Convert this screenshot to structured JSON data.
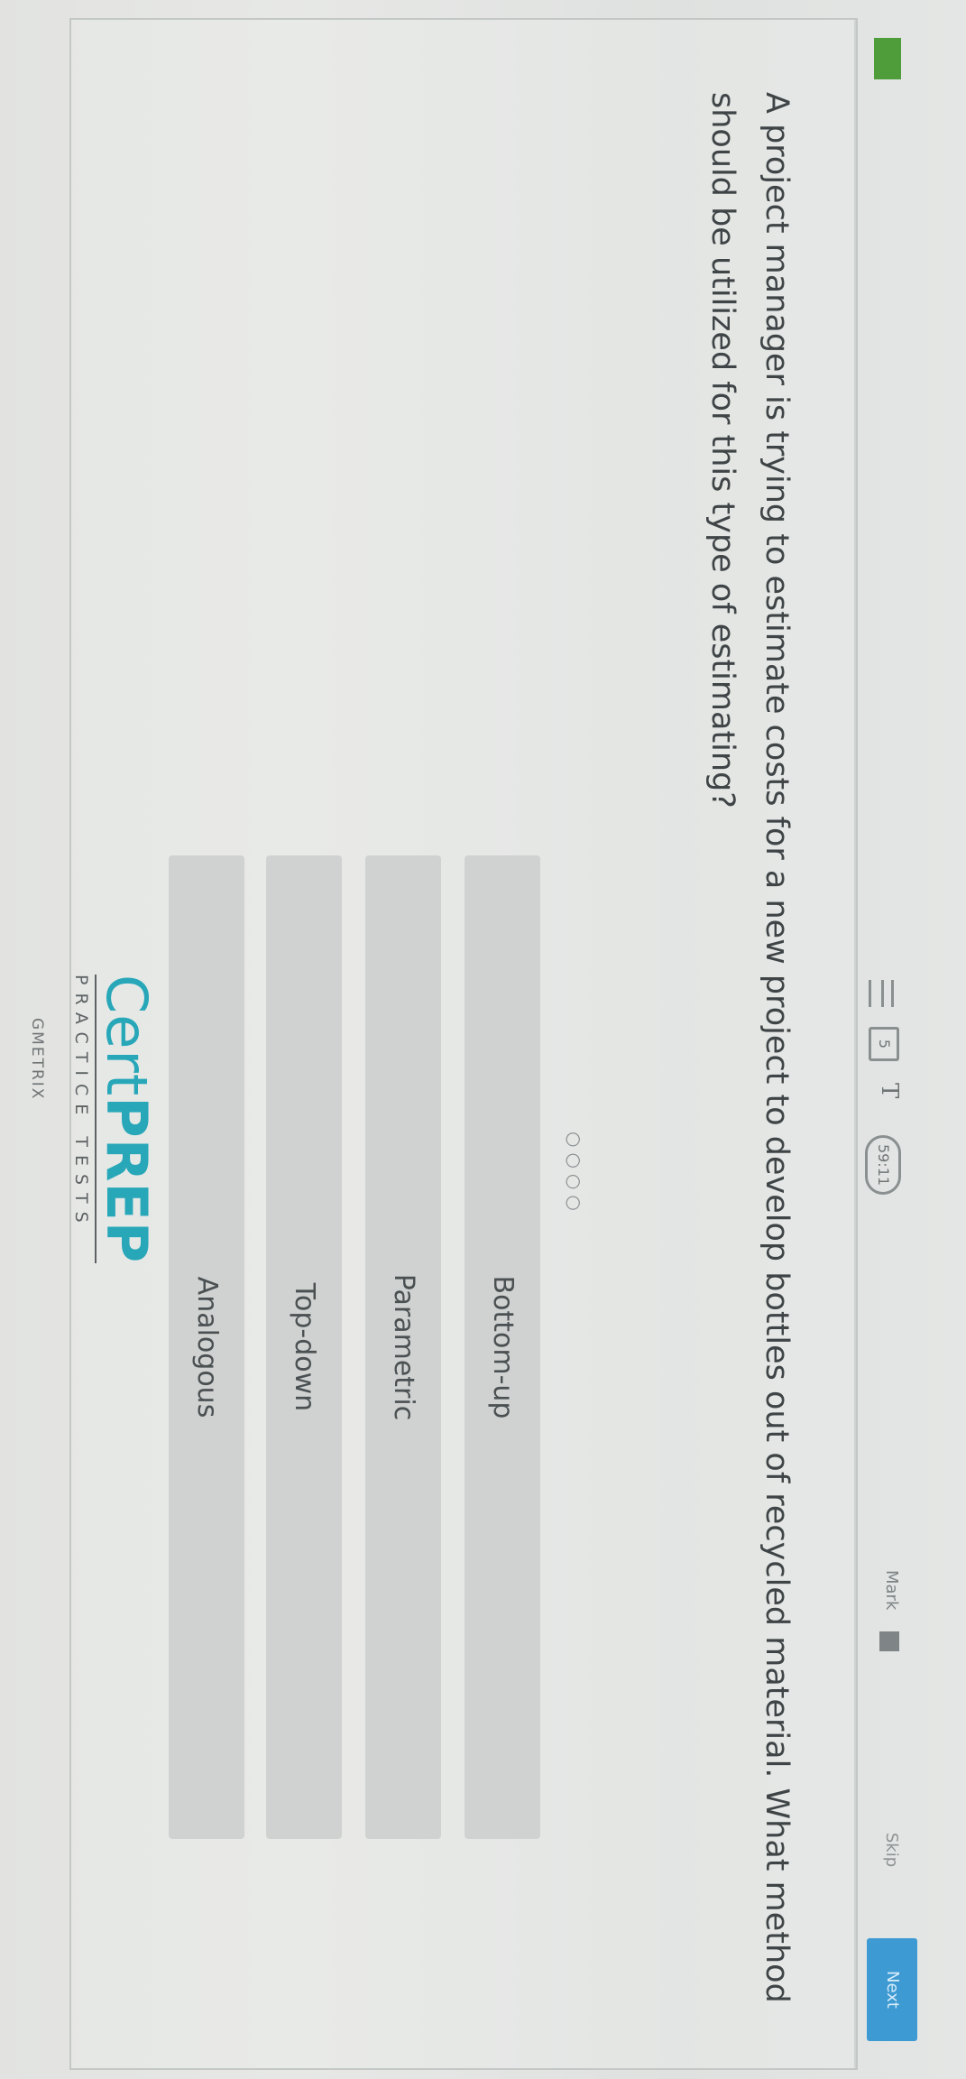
{
  "toolbar": {
    "tool_box_label": "5",
    "tool_text_label": "T",
    "timer": "59:11",
    "mark_label": "Mark",
    "skip_label": "Skip",
    "next_label": "Next"
  },
  "question": {
    "text": "A project manager is trying to estimate costs for a new project to develop bottles out of recycled material. What method should be utilized for this type of estimating?",
    "dots": "○○○○",
    "options": [
      {
        "label": "Bottom-up"
      },
      {
        "label": "Parametric"
      },
      {
        "label": "Top-down"
      },
      {
        "label": "Analogous"
      }
    ]
  },
  "footer": {
    "brand_part1": "Cert",
    "brand_part2": "PREP",
    "brand_sub": "PRACTICE TESTS",
    "publisher": "GMETRIX"
  },
  "colors": {
    "accent": "#3e9ad3",
    "brand": "#27a7b8",
    "indicator": "#4f9d3a"
  }
}
